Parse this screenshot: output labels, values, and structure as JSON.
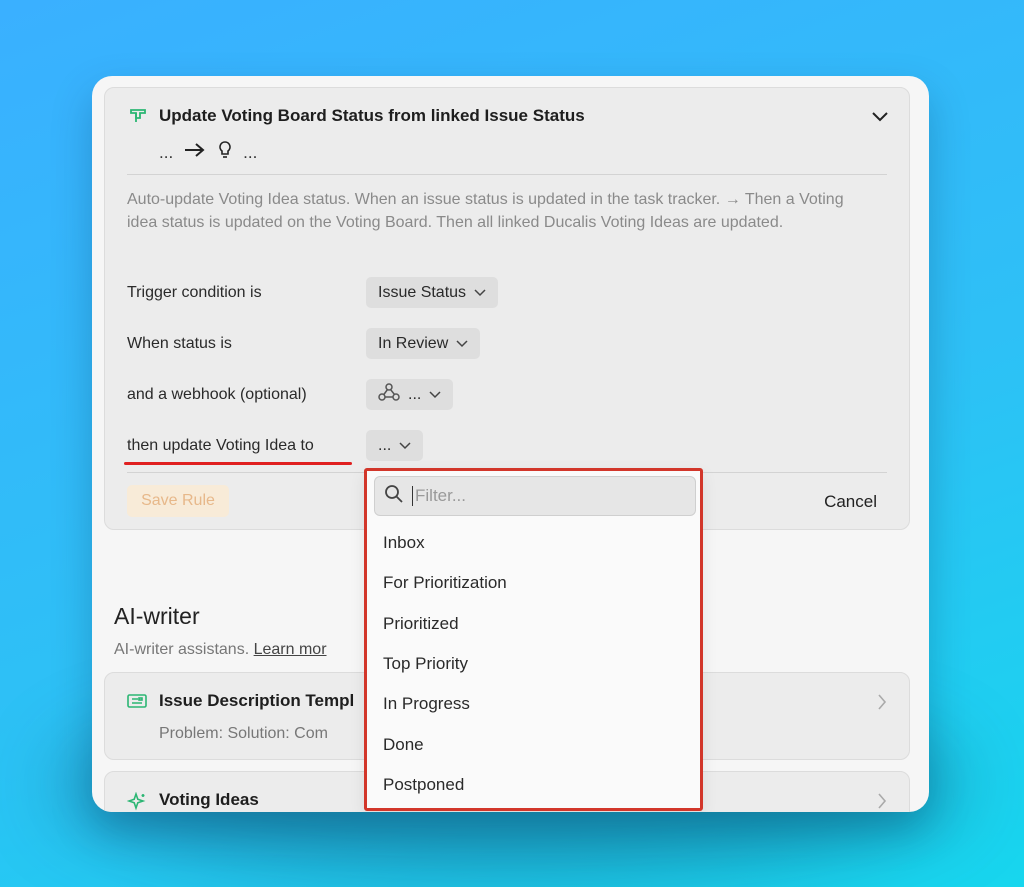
{
  "rule": {
    "title": "Update Voting Board Status from linked Issue Status",
    "flow_left": "...",
    "flow_right": "...",
    "description": "Auto-update Voting Idea status. When an issue status is updated in the task tracker. → Then a Voting idea status is updated on the Voting Board. Then all linked Ducalis Voting Ideas are updated.",
    "rows": [
      {
        "label": "Trigger condition is",
        "value": "Issue Status"
      },
      {
        "label": "When status is",
        "value": "In Review"
      },
      {
        "label": "and a webhook (optional)",
        "value": "..."
      },
      {
        "label": "then update Voting Idea to",
        "value": "..."
      }
    ],
    "save_label": "Save Rule",
    "cancel_label": "Cancel"
  },
  "ai_writer": {
    "title": "AI-writer",
    "subtitle": "AI-writer assistans.",
    "learn_more": "Learn mor"
  },
  "cards": [
    {
      "title": "Issue Description Templ",
      "subtitle": "Problem:  Solution:  Com"
    },
    {
      "title": "Voting Ideas"
    }
  ],
  "dropdown": {
    "filter_placeholder": "Filter...",
    "options": [
      "Inbox",
      "For Prioritization",
      "Prioritized",
      "Top Priority",
      "In Progress",
      "Done",
      "Postponed"
    ]
  },
  "colors": {
    "accent_green": "#2bb673",
    "highlight_red": "#d2362a",
    "save_text": "#e7b88a",
    "save_bg": "#f8ebd8"
  }
}
